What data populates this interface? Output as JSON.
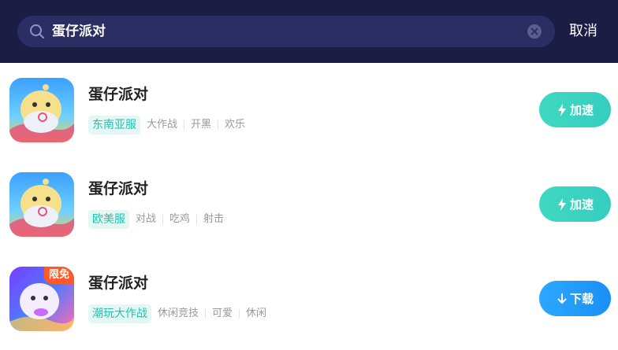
{
  "search": {
    "query": "蛋仔派对",
    "cancel_label": "取消"
  },
  "results": [
    {
      "name": "蛋仔派对",
      "region": "东南亚服",
      "genres": [
        "大作战",
        "开黑",
        "欢乐"
      ],
      "action": "加速",
      "action_icon": "lightning-icon",
      "badge": ""
    },
    {
      "name": "蛋仔派对",
      "region": "欧美服",
      "genres": [
        "对战",
        "吃鸡",
        "射击"
      ],
      "action": "加速",
      "action_icon": "lightning-icon",
      "badge": ""
    },
    {
      "name": "蛋仔派对",
      "region": "潮玩大作战",
      "genres": [
        "休闲竞技",
        "可爱",
        "休闲"
      ],
      "action": "下载",
      "action_icon": "download-arrow-icon",
      "badge": "限免"
    }
  ],
  "colors": {
    "topbar": "#1b1d45",
    "accent_teal": "#3fd9c1",
    "accent_blue": "#2ba8ff",
    "badge_orange": "#ff5a2a"
  }
}
